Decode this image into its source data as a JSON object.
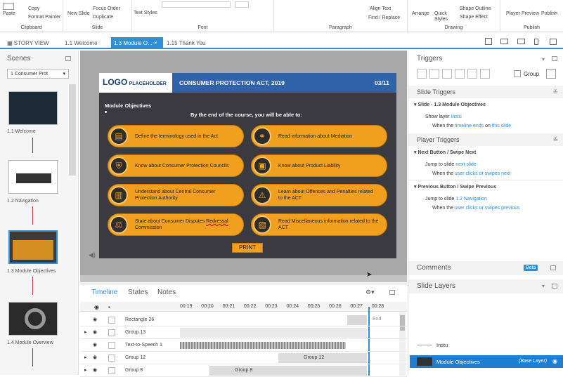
{
  "ribbon": {
    "paste": "Paste",
    "copy": "Copy",
    "format_painter": "Format Painter",
    "clipboard": "Clipboard",
    "new_slide": "New Slide",
    "focus_order": "Focus Order",
    "duplicate": "Duplicate",
    "slide": "Slide",
    "text_styles": "Text Styles",
    "font": "Font",
    "align_text": "Align Text",
    "find_replace": "Find / Replace",
    "paragraph": "Paragraph",
    "arrange": "Arrange",
    "quick_styles": "Quick Styles",
    "shape_outline": "Shape Outline",
    "shape_effect": "Shape Effect",
    "drawing": "Drawing",
    "player": "Player",
    "preview": "Preview",
    "publish_btn": "Publish",
    "publish_group": "Publish"
  },
  "tabs": {
    "story_view": "STORY VIEW",
    "t1": "1.1 Welcome",
    "t2": "1.3 Module O...",
    "t3": "1.15 Thank You"
  },
  "scenes": {
    "title": "Scenes",
    "selected": "1 Consumer Prot",
    "items": [
      "1.1 Welcome",
      "1.2 Navigation",
      "1.3 Module Objectives",
      "1.4 Module Overview"
    ]
  },
  "slide": {
    "logo": "LOGO",
    "logo_sub": "PLACEHOLDER",
    "title": "CONSUMER PROTECTION ACT, 2019",
    "page": "03/11",
    "heading": "Module Objectives",
    "intro": "By the end of the course, you will be able to:",
    "obj1": "Define the terminology used in the Act",
    "obj2": "Read information about Mediation",
    "obj3": "Know about Consumer Protection Councils",
    "obj4": "Know about Product Liability",
    "obj5": "Understand about Central Consumer Protection Authority",
    "obj6": "Learn about Offences and Penalties related to the ACT",
    "obj7a": "State about Consumer Disputes ",
    "obj7b": "Redressal",
    "obj7c": " Commission",
    "obj8": "Read Miscellaneous information related to the ACT",
    "print": "PRINT"
  },
  "timeline": {
    "tab_timeline": "Timeline",
    "tab_states": "States",
    "tab_notes": "Notes",
    "ticks": [
      "00:19",
      "00:20",
      "00:21",
      "00:22",
      "00:23",
      "00:24",
      "00:25",
      "00:26",
      "00:27",
      "00:28"
    ],
    "end": "End",
    "rows": [
      "Rectangle 26",
      "Group 13",
      "Text-to-Speech 1",
      "Group 12",
      "Group 8"
    ],
    "bar_group12": "Group 12",
    "bar_group8": "Group 8"
  },
  "triggers": {
    "title": "Triggers",
    "group": "Group",
    "slide_triggers": "Slide Triggers",
    "slide_item": "Slide - 1.3 Module Objectives",
    "show_layer": "Show layer",
    "show_layer_val": "Instu",
    "when1a": "When the",
    "when1b": "timeline",
    "when1c": "ends",
    "when1d": "on",
    "when1e": "this slide",
    "player_triggers": "Player Triggers",
    "next_btn": "Next Button / Swipe Next",
    "jump1a": "Jump to slide",
    "jump1b": "next slide",
    "when2a": "When the",
    "when2b": "user",
    "when2c": "clicks or swipes",
    "when2d": "next",
    "prev_btn": "Previous Button / Swipe Previous",
    "jump2a": "Jump to slide",
    "jump2b": "1.2 Navigation",
    "when3a": "When the",
    "when3b": "user",
    "when3c": "clicks or swipes",
    "when3d": "previous"
  },
  "comments": {
    "title": "Comments",
    "beta": "Beta"
  },
  "layers": {
    "title": "Slide Layers",
    "l1": "Instu",
    "l2": "Module Objectives",
    "l2_tag": "(Base Layer)"
  }
}
